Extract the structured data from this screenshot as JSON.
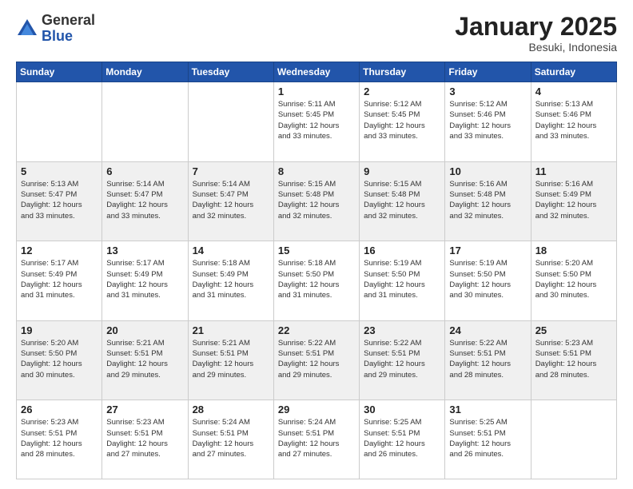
{
  "logo": {
    "general": "General",
    "blue": "Blue"
  },
  "header": {
    "month": "January 2025",
    "location": "Besuki, Indonesia"
  },
  "weekdays": [
    "Sunday",
    "Monday",
    "Tuesday",
    "Wednesday",
    "Thursday",
    "Friday",
    "Saturday"
  ],
  "weeks": [
    [
      {
        "day": "",
        "info": ""
      },
      {
        "day": "",
        "info": ""
      },
      {
        "day": "",
        "info": ""
      },
      {
        "day": "1",
        "info": "Sunrise: 5:11 AM\nSunset: 5:45 PM\nDaylight: 12 hours\nand 33 minutes."
      },
      {
        "day": "2",
        "info": "Sunrise: 5:12 AM\nSunset: 5:45 PM\nDaylight: 12 hours\nand 33 minutes."
      },
      {
        "day": "3",
        "info": "Sunrise: 5:12 AM\nSunset: 5:46 PM\nDaylight: 12 hours\nand 33 minutes."
      },
      {
        "day": "4",
        "info": "Sunrise: 5:13 AM\nSunset: 5:46 PM\nDaylight: 12 hours\nand 33 minutes."
      }
    ],
    [
      {
        "day": "5",
        "info": "Sunrise: 5:13 AM\nSunset: 5:47 PM\nDaylight: 12 hours\nand 33 minutes."
      },
      {
        "day": "6",
        "info": "Sunrise: 5:14 AM\nSunset: 5:47 PM\nDaylight: 12 hours\nand 33 minutes."
      },
      {
        "day": "7",
        "info": "Sunrise: 5:14 AM\nSunset: 5:47 PM\nDaylight: 12 hours\nand 32 minutes."
      },
      {
        "day": "8",
        "info": "Sunrise: 5:15 AM\nSunset: 5:48 PM\nDaylight: 12 hours\nand 32 minutes."
      },
      {
        "day": "9",
        "info": "Sunrise: 5:15 AM\nSunset: 5:48 PM\nDaylight: 12 hours\nand 32 minutes."
      },
      {
        "day": "10",
        "info": "Sunrise: 5:16 AM\nSunset: 5:48 PM\nDaylight: 12 hours\nand 32 minutes."
      },
      {
        "day": "11",
        "info": "Sunrise: 5:16 AM\nSunset: 5:49 PM\nDaylight: 12 hours\nand 32 minutes."
      }
    ],
    [
      {
        "day": "12",
        "info": "Sunrise: 5:17 AM\nSunset: 5:49 PM\nDaylight: 12 hours\nand 31 minutes."
      },
      {
        "day": "13",
        "info": "Sunrise: 5:17 AM\nSunset: 5:49 PM\nDaylight: 12 hours\nand 31 minutes."
      },
      {
        "day": "14",
        "info": "Sunrise: 5:18 AM\nSunset: 5:49 PM\nDaylight: 12 hours\nand 31 minutes."
      },
      {
        "day": "15",
        "info": "Sunrise: 5:18 AM\nSunset: 5:50 PM\nDaylight: 12 hours\nand 31 minutes."
      },
      {
        "day": "16",
        "info": "Sunrise: 5:19 AM\nSunset: 5:50 PM\nDaylight: 12 hours\nand 31 minutes."
      },
      {
        "day": "17",
        "info": "Sunrise: 5:19 AM\nSunset: 5:50 PM\nDaylight: 12 hours\nand 30 minutes."
      },
      {
        "day": "18",
        "info": "Sunrise: 5:20 AM\nSunset: 5:50 PM\nDaylight: 12 hours\nand 30 minutes."
      }
    ],
    [
      {
        "day": "19",
        "info": "Sunrise: 5:20 AM\nSunset: 5:50 PM\nDaylight: 12 hours\nand 30 minutes."
      },
      {
        "day": "20",
        "info": "Sunrise: 5:21 AM\nSunset: 5:51 PM\nDaylight: 12 hours\nand 29 minutes."
      },
      {
        "day": "21",
        "info": "Sunrise: 5:21 AM\nSunset: 5:51 PM\nDaylight: 12 hours\nand 29 minutes."
      },
      {
        "day": "22",
        "info": "Sunrise: 5:22 AM\nSunset: 5:51 PM\nDaylight: 12 hours\nand 29 minutes."
      },
      {
        "day": "23",
        "info": "Sunrise: 5:22 AM\nSunset: 5:51 PM\nDaylight: 12 hours\nand 29 minutes."
      },
      {
        "day": "24",
        "info": "Sunrise: 5:22 AM\nSunset: 5:51 PM\nDaylight: 12 hours\nand 28 minutes."
      },
      {
        "day": "25",
        "info": "Sunrise: 5:23 AM\nSunset: 5:51 PM\nDaylight: 12 hours\nand 28 minutes."
      }
    ],
    [
      {
        "day": "26",
        "info": "Sunrise: 5:23 AM\nSunset: 5:51 PM\nDaylight: 12 hours\nand 28 minutes."
      },
      {
        "day": "27",
        "info": "Sunrise: 5:23 AM\nSunset: 5:51 PM\nDaylight: 12 hours\nand 27 minutes."
      },
      {
        "day": "28",
        "info": "Sunrise: 5:24 AM\nSunset: 5:51 PM\nDaylight: 12 hours\nand 27 minutes."
      },
      {
        "day": "29",
        "info": "Sunrise: 5:24 AM\nSunset: 5:51 PM\nDaylight: 12 hours\nand 27 minutes."
      },
      {
        "day": "30",
        "info": "Sunrise: 5:25 AM\nSunset: 5:51 PM\nDaylight: 12 hours\nand 26 minutes."
      },
      {
        "day": "31",
        "info": "Sunrise: 5:25 AM\nSunset: 5:51 PM\nDaylight: 12 hours\nand 26 minutes."
      },
      {
        "day": "",
        "info": ""
      }
    ]
  ]
}
